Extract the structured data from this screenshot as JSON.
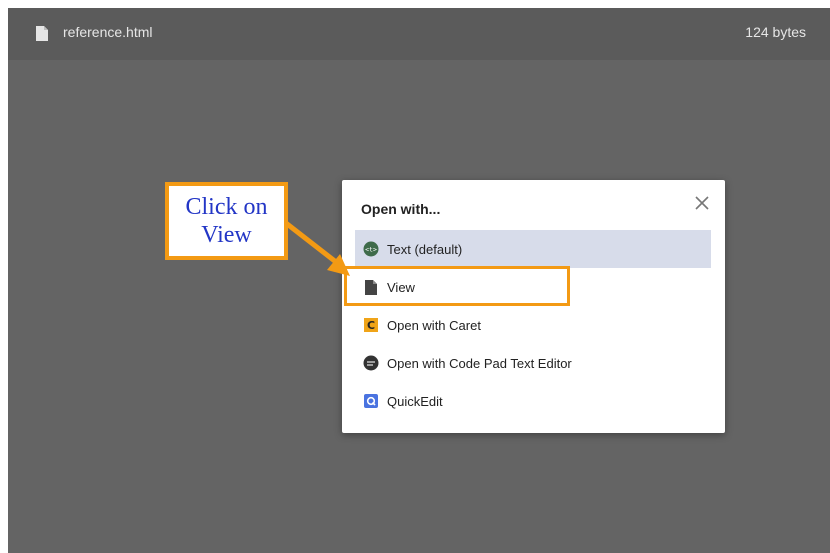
{
  "header": {
    "file_name": "reference.html",
    "file_size": "124 bytes",
    "file_icon": "file-icon"
  },
  "dialog": {
    "title": "Open with...",
    "close_icon": "close-icon",
    "items": [
      {
        "label": "Text (default)",
        "icon": "text-editor-icon",
        "selected": true
      },
      {
        "label": "View",
        "icon": "file-icon",
        "selected": false
      },
      {
        "label": "Open with Caret",
        "icon": "caret-app-icon",
        "selected": false
      },
      {
        "label": "Open with Code Pad Text Editor",
        "icon": "code-pad-icon",
        "selected": false
      },
      {
        "label": "QuickEdit",
        "icon": "quickedit-icon",
        "selected": false
      }
    ]
  },
  "annotation": {
    "line1": "Click on",
    "line2": "View",
    "accent": "#f39a14",
    "text_color": "#2336c6"
  },
  "colors": {
    "backdrop": "#646464",
    "topbar": "#5b5b5b",
    "selected_item": "#d7dcea"
  }
}
